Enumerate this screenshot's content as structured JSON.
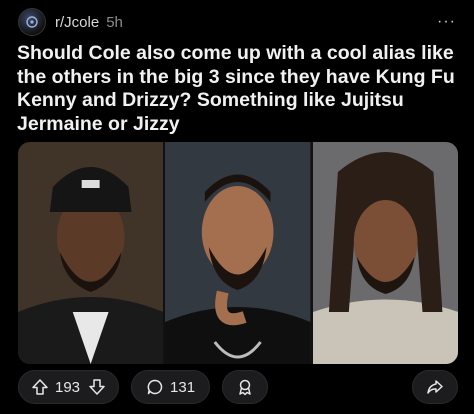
{
  "post": {
    "subreddit": "r/Jcole",
    "time": "5h",
    "more": "···",
    "title": "Should Cole also come up with a cool alias like the others in the big 3 since they have Kung Fu Kenny and Drizzy? Something like Jujitsu Jermaine or Jizzy"
  },
  "actions": {
    "upvotes": "193",
    "comments": "131"
  },
  "icons": [
    "subreddit-avatar-icon",
    "upvote-icon",
    "downvote-icon",
    "comment-icon",
    "award-icon",
    "share-icon"
  ],
  "colors": {
    "background": "#000000",
    "pill": "#1c1c1e",
    "text": "#f1f1f1",
    "muted": "#8c8c8c"
  }
}
